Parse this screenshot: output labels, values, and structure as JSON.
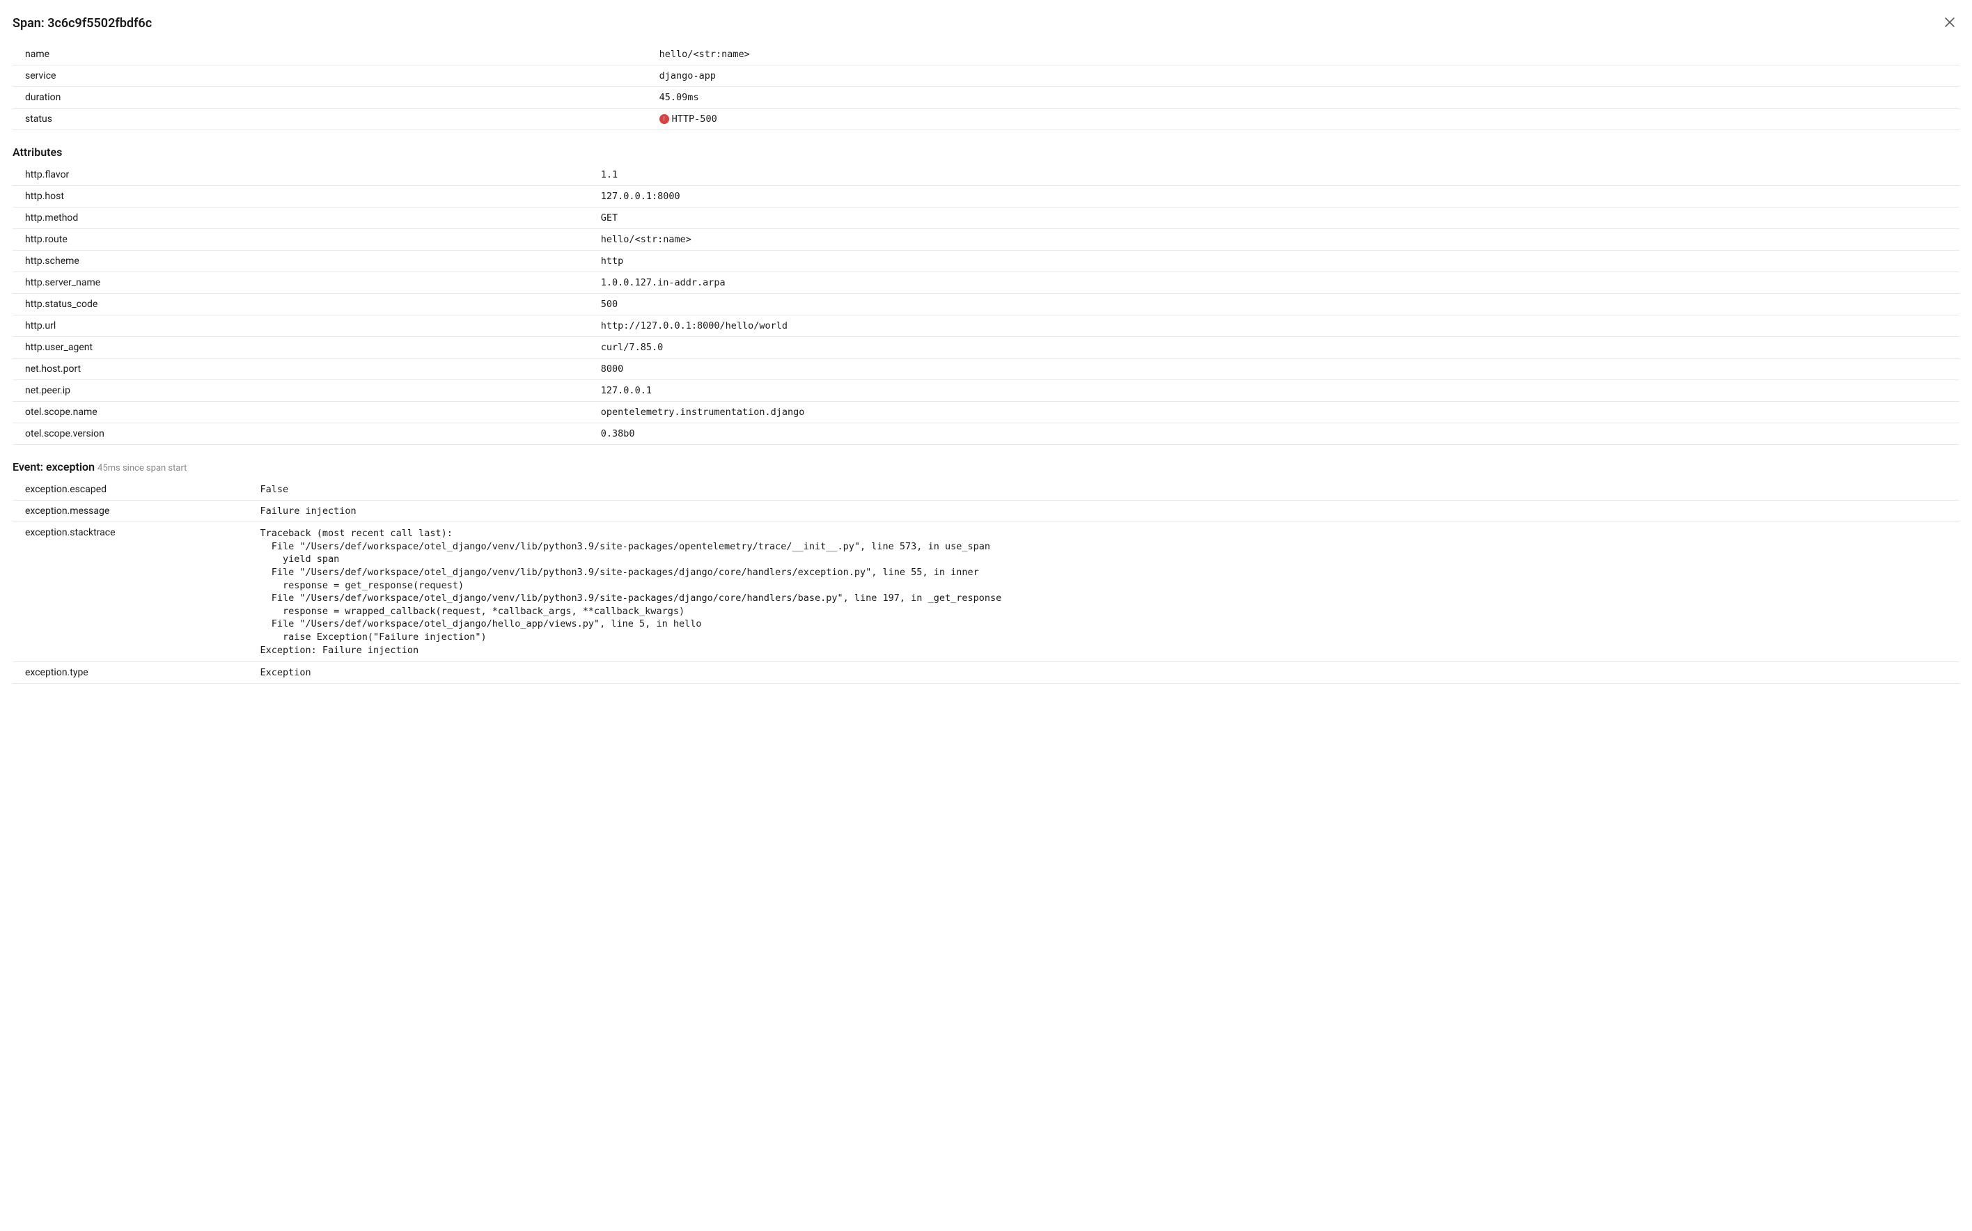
{
  "header": {
    "title_prefix": "Span: ",
    "span_id": "3c6c9f5502fbdf6c"
  },
  "summary": [
    {
      "key": "name",
      "value": "hello/<str:name>"
    },
    {
      "key": "service",
      "value": "django-app"
    },
    {
      "key": "duration",
      "value": "45.09ms"
    },
    {
      "key": "status",
      "value": "HTTP-500",
      "error": true
    }
  ],
  "attributes_heading": "Attributes",
  "attributes": [
    {
      "key": "http.flavor",
      "value": "1.1"
    },
    {
      "key": "http.host",
      "value": "127.0.0.1:8000"
    },
    {
      "key": "http.method",
      "value": "GET"
    },
    {
      "key": "http.route",
      "value": "hello/<str:name>"
    },
    {
      "key": "http.scheme",
      "value": "http"
    },
    {
      "key": "http.server_name",
      "value": "1.0.0.127.in-addr.arpa"
    },
    {
      "key": "http.status_code",
      "value": "500"
    },
    {
      "key": "http.url",
      "value": "http://127.0.0.1:8000/hello/world"
    },
    {
      "key": "http.user_agent",
      "value": "curl/7.85.0"
    },
    {
      "key": "net.host.port",
      "value": "8000"
    },
    {
      "key": "net.peer.ip",
      "value": "127.0.0.1"
    },
    {
      "key": "otel.scope.name",
      "value": "opentelemetry.instrumentation.django"
    },
    {
      "key": "otel.scope.version",
      "value": "0.38b0"
    }
  ],
  "event": {
    "heading_prefix": "Event: ",
    "name": "exception",
    "since": "45ms since span start",
    "rows": [
      {
        "key": "exception.escaped",
        "value": "False"
      },
      {
        "key": "exception.message",
        "value": "Failure injection"
      },
      {
        "key": "exception.stacktrace",
        "pre": true,
        "value": "Traceback (most recent call last):\n  File \"/Users/def/workspace/otel_django/venv/lib/python3.9/site-packages/opentelemetry/trace/__init__.py\", line 573, in use_span\n    yield span\n  File \"/Users/def/workspace/otel_django/venv/lib/python3.9/site-packages/django/core/handlers/exception.py\", line 55, in inner\n    response = get_response(request)\n  File \"/Users/def/workspace/otel_django/venv/lib/python3.9/site-packages/django/core/handlers/base.py\", line 197, in _get_response\n    response = wrapped_callback(request, *callback_args, **callback_kwargs)\n  File \"/Users/def/workspace/otel_django/hello_app/views.py\", line 5, in hello\n    raise Exception(\"Failure injection\")\nException: Failure injection"
      },
      {
        "key": "exception.type",
        "value": "Exception"
      }
    ]
  }
}
